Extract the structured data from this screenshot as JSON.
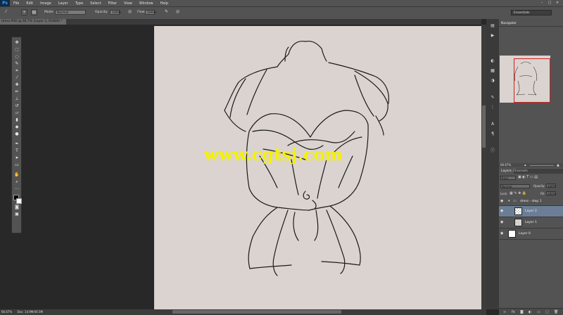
{
  "app": {
    "logo": "Ps"
  },
  "menu": [
    "File",
    "Edit",
    "Image",
    "Layer",
    "Type",
    "Select",
    "Filter",
    "View",
    "Window",
    "Help"
  ],
  "window_controls": {
    "minimize": "–",
    "maximize": "□",
    "close": "✕"
  },
  "options": {
    "mode_label": "Mode:",
    "mode_value": "Normal",
    "opacity_label": "Opacity:",
    "opacity_value": "100%",
    "flow_label": "Flow:",
    "flow_value": "100%",
    "workspace": "Essentials"
  },
  "document": {
    "tab_title": "dress.PSD @ 66.7% (Layer 2, RGB/8) *",
    "tab_close": "×"
  },
  "status": {
    "zoom": "66.67%",
    "doc": "Doc: 14.9M/40.5M"
  },
  "watermark": "www.cgtsj.com",
  "navigator": {
    "tab": "Navigator",
    "zoom": "66.67%"
  },
  "layers_panel": {
    "tabs": [
      "Layers",
      "Channels"
    ],
    "kind": "Kind",
    "blend": "Normal",
    "opacity_label": "Opacity:",
    "opacity_value": "100%",
    "lock_label": "Lock:",
    "fill_label": "Fill:",
    "fill_value": "100%",
    "layers": [
      {
        "name": "dress - step 1",
        "type": "group"
      },
      {
        "name": "Layer 2",
        "type": "layer",
        "selected": true
      },
      {
        "name": "Layer 1",
        "type": "layer"
      },
      {
        "name": "Layer 0",
        "type": "layer"
      }
    ]
  },
  "colors": {
    "canvas": "#dbd3d0",
    "ui_panel": "#535353",
    "ui_dark": "#282828",
    "watermark": "#f5f200",
    "nav_rect": "#d0201e",
    "selected_layer": "#6b7e96"
  }
}
